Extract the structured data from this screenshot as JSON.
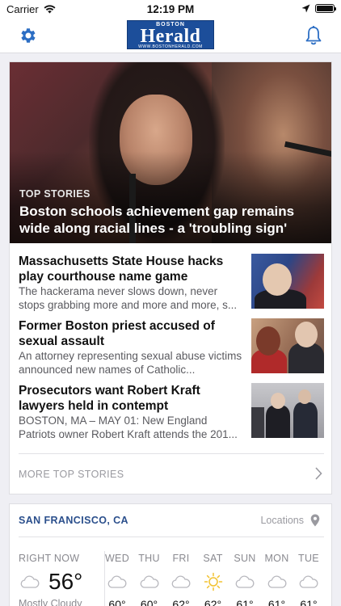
{
  "status_bar": {
    "carrier": "Carrier",
    "time": "12:19 PM"
  },
  "nav": {
    "logo_top": "BOSTON",
    "logo_main": "Herald",
    "logo_bottom": "WWW.BOSTONHERALD.COM"
  },
  "top_stories": {
    "hero": {
      "kicker": "TOP STORIES",
      "title": "Boston schools achievement gap remains wide along racial lines - a 'troubling sign'"
    },
    "items": [
      {
        "title": "Massachusetts State House hacks play courthouse name game",
        "summary": "The hackerama never slows down, never stops grabbing more and more and more, s..."
      },
      {
        "title": "Former Boston priest accused of sexual assault",
        "summary": "An attorney representing sexual abuse victims announced new names of Catholic..."
      },
      {
        "title": "Prosecutors want Robert Kraft lawyers held in contempt",
        "summary": "BOSTON, MA – MAY 01: New England Patriots owner Robert Kraft attends the 201..."
      }
    ],
    "more_label": "MORE TOP STORIES"
  },
  "weather": {
    "city": "SAN FRANCISCO, CA",
    "locations_label": "Locations",
    "now": {
      "label": "RIGHT NOW",
      "temp": "56°",
      "condition": "Mostly Cloudy"
    },
    "forecast": [
      {
        "day": "WED",
        "icon": "cloud-icon",
        "temp": "60°"
      },
      {
        "day": "THU",
        "icon": "cloud-icon",
        "temp": "60°"
      },
      {
        "day": "FRI",
        "icon": "cloud-icon",
        "temp": "62°"
      },
      {
        "day": "SAT",
        "icon": "sun-icon",
        "temp": "62°"
      },
      {
        "day": "SUN",
        "icon": "cloud-icon",
        "temp": "61°"
      },
      {
        "day": "MON",
        "icon": "cloud-icon",
        "temp": "61°"
      },
      {
        "day": "TUE",
        "icon": "cloud-icon",
        "temp": "61°"
      }
    ]
  },
  "colors": {
    "accent": "#2b4f8c",
    "logo_blue": "#1c4e9a",
    "icon_blue": "#2c6ec4",
    "sun": "#f2c230"
  }
}
